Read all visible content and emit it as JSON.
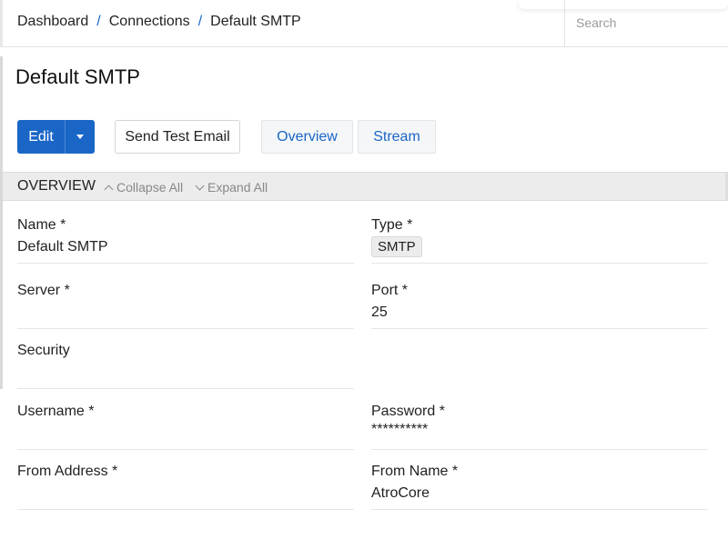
{
  "breadcrumb": {
    "items": [
      "Dashboard",
      "Connections",
      "Default SMTP"
    ],
    "separator": "/"
  },
  "search": {
    "placeholder": "Search",
    "value": ""
  },
  "page": {
    "title": "Default SMTP"
  },
  "toolbar": {
    "edit_label": "Edit",
    "send_test_label": "Send Test Email",
    "tab_overview": "Overview",
    "tab_stream": "Stream"
  },
  "panel": {
    "title": "OVERVIEW",
    "collapse_label": "Collapse All",
    "expand_label": "Expand All"
  },
  "fields": {
    "name": {
      "label": "Name *",
      "value": "Default SMTP"
    },
    "type": {
      "label": "Type *",
      "value": "SMTP"
    },
    "server": {
      "label": "Server *",
      "value": ""
    },
    "port": {
      "label": "Port *",
      "value": "25"
    },
    "security": {
      "label": "Security",
      "value": ""
    },
    "username": {
      "label": "Username *",
      "value": ""
    },
    "password": {
      "label": "Password *",
      "value": "**********"
    },
    "from_address": {
      "label": "From Address *",
      "value": ""
    },
    "from_name": {
      "label": "From Name *",
      "value": "AtroCore"
    }
  },
  "colors": {
    "primary": "#1a66c7",
    "link": "#1a66c7",
    "panel_header_bg": "#ececec",
    "muted_text": "#888888"
  },
  "icons": {
    "caret": "caret-down-icon",
    "collapse": "chevron-up-icon",
    "expand": "chevron-down-icon"
  }
}
